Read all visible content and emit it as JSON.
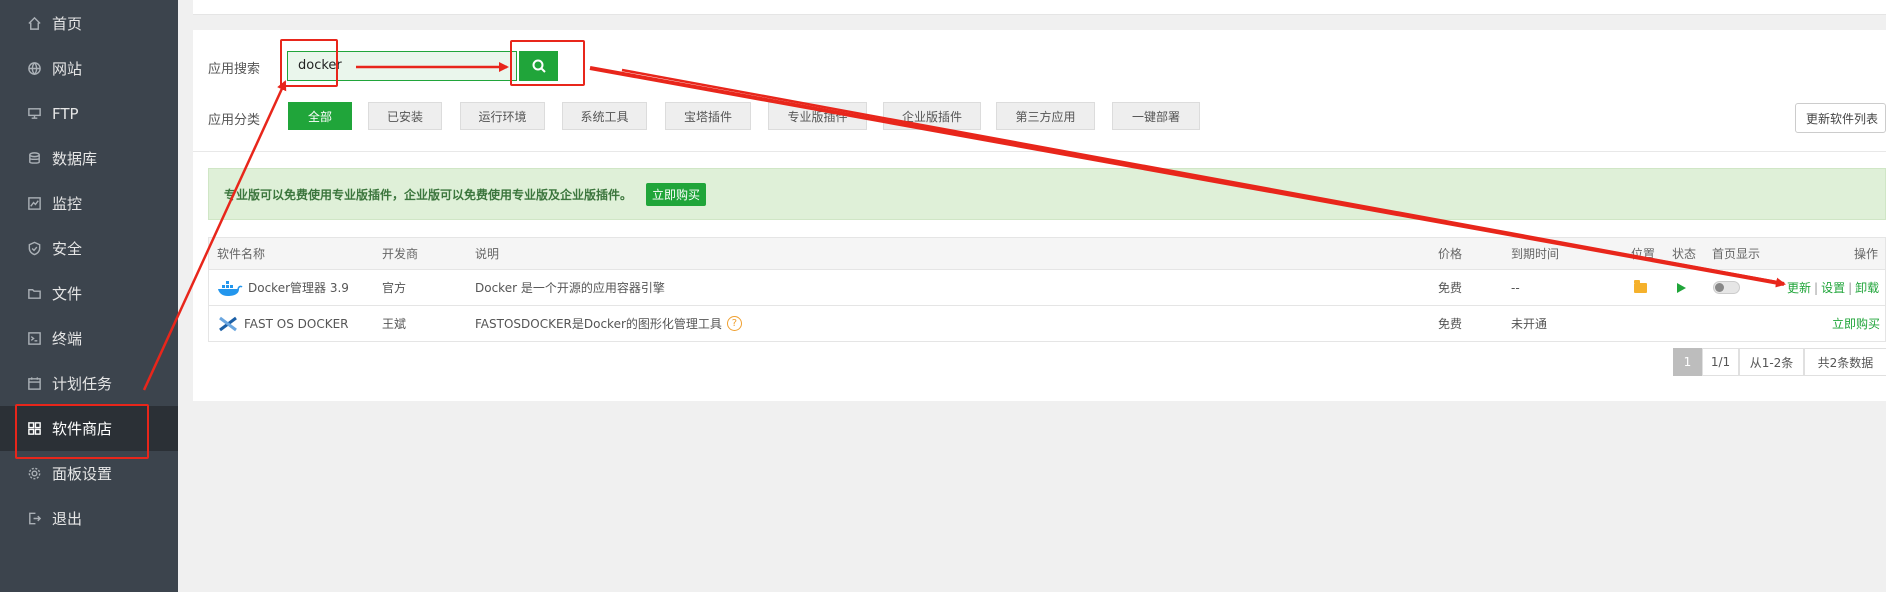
{
  "sidebar": {
    "items": [
      {
        "label": "首页",
        "icon": "home-icon"
      },
      {
        "label": "网站",
        "icon": "globe-icon"
      },
      {
        "label": "FTP",
        "icon": "ftp-icon"
      },
      {
        "label": "数据库",
        "icon": "database-icon"
      },
      {
        "label": "监控",
        "icon": "monitor-icon"
      },
      {
        "label": "安全",
        "icon": "shield-icon"
      },
      {
        "label": "文件",
        "icon": "folder-icon"
      },
      {
        "label": "终端",
        "icon": "terminal-icon"
      },
      {
        "label": "计划任务",
        "icon": "calendar-icon"
      },
      {
        "label": "软件商店",
        "icon": "grid-icon",
        "active": true
      },
      {
        "label": "面板设置",
        "icon": "gear-icon"
      },
      {
        "label": "退出",
        "icon": "logout-icon"
      }
    ]
  },
  "search": {
    "label": "应用搜索",
    "value": "docker",
    "button_icon": "search-icon"
  },
  "categories": {
    "label": "应用分类",
    "items": [
      "全部",
      "已安装",
      "运行环境",
      "系统工具",
      "宝塔插件",
      "专业版插件",
      "企业版插件",
      "第三方应用",
      "一键部署"
    ],
    "active_index": 0
  },
  "update_list_button": "更新软件列表",
  "notice": {
    "text": "专业版可以免费使用专业版插件，企业版可以免费使用专业版及企业版插件。",
    "buy_label": "立即购买"
  },
  "table": {
    "headers": {
      "name": "软件名称",
      "developer": "开发商",
      "description": "说明",
      "price": "价格",
      "expiry": "到期时间",
      "location": "位置",
      "status": "状态",
      "homepage": "首页显示",
      "actions": "操作"
    },
    "rows": [
      {
        "name": "Docker管理器 3.9",
        "developer": "官方",
        "description": "Docker 是一个开源的应用容器引擎",
        "price": "免费",
        "expiry": "--",
        "actions": [
          "更新",
          "设置",
          "卸载"
        ],
        "action_sep": "|"
      },
      {
        "name": "FAST OS DOCKER",
        "developer": "王斌",
        "description": "FASTOSDOCKER是Docker的图形化管理工具",
        "help_icon": "?",
        "price": "免费",
        "expiry": "未开通",
        "buy_label": "立即购买"
      }
    ]
  },
  "pagination": {
    "current": "1",
    "pages": "1/1",
    "range": "从1-2条",
    "total": "共2条数据"
  },
  "colors": {
    "sidebar_bg": "#3c444d",
    "accent_green": "#20a53a",
    "annotation_red": "#e8261b"
  }
}
